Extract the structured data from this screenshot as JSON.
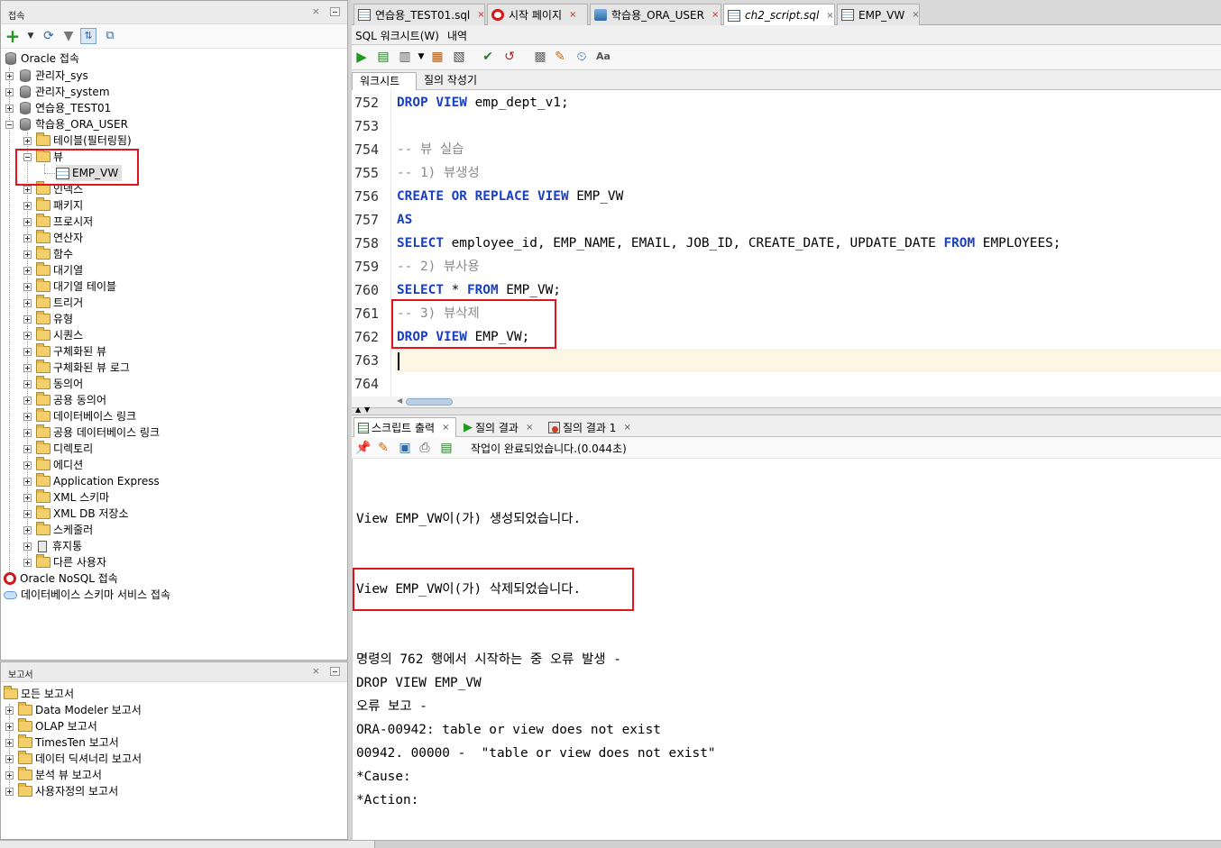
{
  "connections_panel": {
    "title": "접속",
    "close": "×",
    "tree": [
      {
        "label": "Oracle 접속"
      },
      {
        "label": "관리자_sys"
      },
      {
        "label": "관리자_system"
      },
      {
        "label": "연습용_TEST01"
      },
      {
        "label": "학습용_ORA_USER"
      },
      {
        "label": "테이블(필터링됨)"
      },
      {
        "label": "뷰"
      },
      {
        "label": "EMP_VW"
      },
      {
        "label": "인덱스"
      },
      {
        "label": "패키지"
      },
      {
        "label": "프로시저"
      },
      {
        "label": "연산자"
      },
      {
        "label": "함수"
      },
      {
        "label": "대기열"
      },
      {
        "label": "대기열 테이블"
      },
      {
        "label": "트리거"
      },
      {
        "label": "유형"
      },
      {
        "label": "시퀀스"
      },
      {
        "label": "구체화된 뷰"
      },
      {
        "label": "구체화된 뷰 로그"
      },
      {
        "label": "동의어"
      },
      {
        "label": "공용 동의어"
      },
      {
        "label": "데이터베이스 링크"
      },
      {
        "label": "공용 데이터베이스 링크"
      },
      {
        "label": "디렉토리"
      },
      {
        "label": "에디션"
      },
      {
        "label": "Application Express"
      },
      {
        "label": "XML 스키마"
      },
      {
        "label": "XML DB 저장소"
      },
      {
        "label": "스케줄러"
      },
      {
        "label": "휴지통"
      },
      {
        "label": "다른 사용자"
      },
      {
        "label": "Oracle NoSQL 접속"
      },
      {
        "label": "데이터베이스 스키마 서비스 접속"
      }
    ]
  },
  "reports_panel": {
    "title": "보고서",
    "close": "×",
    "tree": [
      {
        "label": "모든 보고서"
      },
      {
        "label": "Data Modeler 보고서"
      },
      {
        "label": "OLAP 보고서"
      },
      {
        "label": "TimesTen 보고서"
      },
      {
        "label": "데이터 딕셔너리 보고서"
      },
      {
        "label": "분석 뷰 보고서"
      },
      {
        "label": "사용자정의 보고서"
      }
    ]
  },
  "file_tabs": [
    {
      "label": "연습용_TEST01.sql",
      "icon": "sql-file-icon",
      "close": "×"
    },
    {
      "label": "시작 페이지",
      "icon": "oracle-icon",
      "close": "×"
    },
    {
      "label": "학습용_ORA_USER",
      "icon": "connection-icon",
      "close": "×"
    },
    {
      "label": "ch2_script.sql",
      "icon": "sql-file-icon",
      "close": "×"
    },
    {
      "label": "EMP_VW",
      "icon": "view-icon",
      "close": "×"
    }
  ],
  "editor_subtabs": {
    "sql_worksheet": "SQL 워크시트(W)",
    "history": "내역"
  },
  "worksheet_tabs": {
    "worksheet": "워크시트",
    "query_builder": "질의 작성기"
  },
  "code_lines": [
    {
      "n": "752",
      "parts": [
        {
          "t": "DROP VIEW",
          "c": "kw"
        },
        {
          "t": " emp_dept_v1;",
          "c": ""
        }
      ]
    },
    {
      "n": "753",
      "parts": []
    },
    {
      "n": "754",
      "parts": [
        {
          "t": "-- 뷰 실습",
          "c": "cm"
        }
      ]
    },
    {
      "n": "755",
      "parts": [
        {
          "t": "-- 1) 뷰생성",
          "c": "cm"
        }
      ]
    },
    {
      "n": "756",
      "parts": [
        {
          "t": "CREATE OR REPLACE VIEW",
          "c": "kw"
        },
        {
          "t": " EMP_VW",
          "c": ""
        }
      ]
    },
    {
      "n": "757",
      "parts": [
        {
          "t": "AS",
          "c": "kw"
        }
      ]
    },
    {
      "n": "758",
      "parts": [
        {
          "t": "SELECT",
          "c": "kw"
        },
        {
          "t": " employee_id, EMP_NAME, EMAIL, JOB_ID, CREATE_DATE, UPDATE_DATE ",
          "c": ""
        },
        {
          "t": "FROM",
          "c": "kw"
        },
        {
          "t": " EMPLOYEES;",
          "c": ""
        }
      ]
    },
    {
      "n": "759",
      "parts": [
        {
          "t": "-- 2) 뷰사용",
          "c": "cm"
        }
      ]
    },
    {
      "n": "760",
      "parts": [
        {
          "t": "SELECT",
          "c": "kw"
        },
        {
          "t": " * ",
          "c": ""
        },
        {
          "t": "FROM",
          "c": "kw"
        },
        {
          "t": " EMP_VW;",
          "c": ""
        }
      ]
    },
    {
      "n": "761",
      "parts": [
        {
          "t": "-- 3) 뷰삭제",
          "c": "cm"
        }
      ]
    },
    {
      "n": "762",
      "parts": [
        {
          "t": "DROP VIEW",
          "c": "kw"
        },
        {
          "t": " EMP_VW;",
          "c": ""
        }
      ]
    },
    {
      "n": "763",
      "parts": []
    },
    {
      "n": "764",
      "parts": []
    }
  ],
  "output_tabs": [
    {
      "label": "스크립트 출력",
      "close": "×"
    },
    {
      "label": "질의 결과",
      "close": "×"
    },
    {
      "label": "질의 결과 1",
      "close": "×"
    }
  ],
  "output_status": "작업이 완료되었습니다.(0.044초)",
  "output_lines": [
    "View EMP_VW이(가) 생성되었습니다.",
    "View EMP_VW이(가) 삭제되었습니다.",
    "명령의 762 행에서 시작하는 중 오류 발생 -",
    "DROP VIEW EMP_VW",
    "오류 보고 -",
    "ORA-00942: table or view does not exist",
    "00942. 00000 -  \"table or view does not exist\"",
    "*Cause:",
    "*Action:"
  ],
  "colors": {
    "keyword": "#1a3fbf",
    "comment": "#8a8a8a",
    "highlight": "#e0141a"
  }
}
